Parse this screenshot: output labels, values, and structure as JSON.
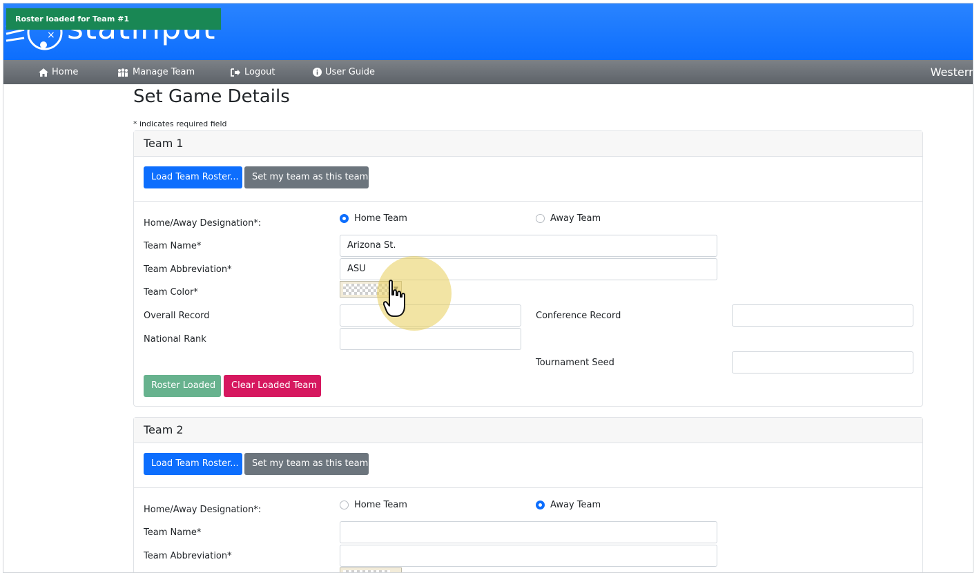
{
  "toast": {
    "text": "Roster loaded for Team #1",
    "color": "#198754"
  },
  "app": {
    "logo_text": "statinput",
    "accent": "#0d6efd"
  },
  "nav": {
    "items": [
      {
        "label": "Home",
        "icon": "home-icon"
      },
      {
        "label": "Manage Team",
        "icon": "users-icon"
      },
      {
        "label": "Logout",
        "icon": "logout-icon"
      },
      {
        "label": "User Guide",
        "icon": "info-icon"
      }
    ],
    "right_text": "Western University"
  },
  "page": {
    "title": "Set Game Details",
    "required_note": "* indicates required field"
  },
  "team1": {
    "header": "Team 1",
    "load_roster": "Load Team Roster...",
    "set_my_team": "Set my team as this team",
    "home_away_label": "Home/Away Designation*:",
    "home_label": "Home Team",
    "away_label": "Away Team",
    "selected": "home",
    "team_name_label": "Team Name*",
    "team_name_value": "Arizona St.",
    "abbr_label": "Team Abbreviation*",
    "abbr_value": "ASU",
    "color_label": "Team Color*",
    "overall_label": "Overall Record",
    "overall_value": "",
    "conference_label": "Conference Record",
    "conference_value": "",
    "rank_label": "National Rank",
    "rank_value": "",
    "seed_label": "Tournament Seed",
    "seed_value": "",
    "roster_loaded": "Roster Loaded",
    "clear_loaded": "Clear Loaded Team"
  },
  "team2": {
    "header": "Team 2",
    "load_roster": "Load Team Roster...",
    "set_my_team": "Set my team as this team",
    "home_away_label": "Home/Away Designation*:",
    "home_label": "Home Team",
    "away_label": "Away Team",
    "selected": "away",
    "team_name_label": "Team Name*",
    "team_name_value": "",
    "abbr_label": "Team Abbreviation*",
    "abbr_value": ""
  }
}
